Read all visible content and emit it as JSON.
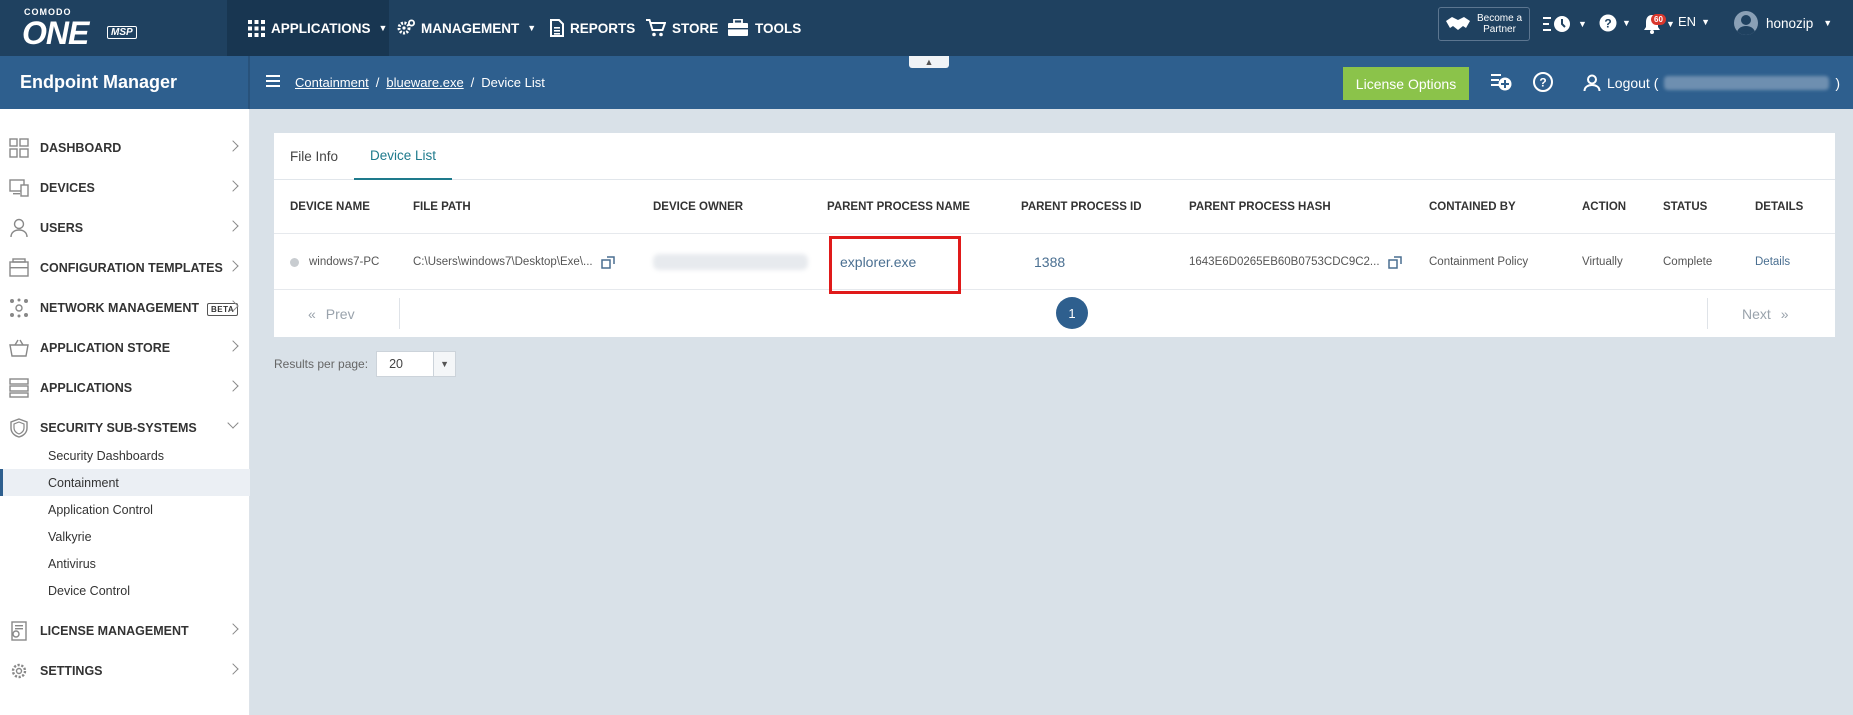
{
  "topbar": {
    "logo_brand": "COMODO",
    "logo_one": "ONE",
    "logo_msp": "MSP",
    "nav": [
      {
        "label": "APPLICATIONS",
        "icon": "grid-icon"
      },
      {
        "label": "MANAGEMENT",
        "icon": "gears-icon"
      },
      {
        "label": "REPORTS",
        "icon": "report-icon"
      },
      {
        "label": "STORE",
        "icon": "cart-icon"
      },
      {
        "label": "TOOLS",
        "icon": "toolbox-icon"
      }
    ],
    "partner_line1": "Become a",
    "partner_line2": "Partner",
    "notification_count": "60",
    "language": "EN",
    "username": "honozip"
  },
  "subbar": {
    "title": "Endpoint Manager",
    "breadcrumb": [
      "Containment",
      "blueware.exe",
      "Device List"
    ],
    "separator": "/",
    "license_button": "License Options",
    "logout_prefix": "Logout (",
    "logout_suffix": ")"
  },
  "sidebar": {
    "items": [
      {
        "label": "DASHBOARD",
        "icon": "dashboard-icon"
      },
      {
        "label": "DEVICES",
        "icon": "devices-icon"
      },
      {
        "label": "USERS",
        "icon": "user-icon"
      },
      {
        "label": "CONFIGURATION TEMPLATES",
        "icon": "templates-icon"
      },
      {
        "label": "NETWORK MANAGEMENT",
        "icon": "network-icon",
        "badge": "BETA"
      },
      {
        "label": "APPLICATION STORE",
        "icon": "store-basket-icon"
      },
      {
        "label": "APPLICATIONS",
        "icon": "applications-icon"
      },
      {
        "label": "SECURITY SUB-SYSTEMS",
        "icon": "shield-icon"
      },
      {
        "label": "LICENSE MANAGEMENT",
        "icon": "license-icon"
      },
      {
        "label": "SETTINGS",
        "icon": "gear-icon"
      }
    ],
    "security_subitems": [
      "Security Dashboards",
      "Containment",
      "Application Control",
      "Valkyrie",
      "Antivirus",
      "Device Control"
    ],
    "active_subitem": "Containment"
  },
  "tabs": [
    "File Info",
    "Device List"
  ],
  "active_tab": "Device List",
  "table": {
    "headers": [
      "DEVICE NAME",
      "FILE PATH",
      "DEVICE OWNER",
      "PARENT PROCESS NAME",
      "PARENT PROCESS ID",
      "PARENT PROCESS HASH",
      "CONTAINED BY",
      "ACTION",
      "STATUS",
      "DETAILS"
    ],
    "rows": [
      {
        "device_name": "windows7-PC",
        "file_path": "C:\\Users\\windows7\\Desktop\\Exe\\...",
        "device_owner": "",
        "parent_process_name": "explorer.exe",
        "parent_process_id": "1388",
        "parent_process_hash": "1643E6D0265EB60B0753CDC9C2...",
        "contained_by": "Containment Policy",
        "action": "Virtually",
        "status": "Complete",
        "details": "Details"
      }
    ]
  },
  "pagination": {
    "prev": "Prev",
    "next": "Next",
    "current_page": "1"
  },
  "results_per_page": {
    "label": "Results per page:",
    "value": "20"
  },
  "colors": {
    "topbar": "#1f4160",
    "subbar": "#2e5f8e",
    "license_button": "#8bc34a",
    "highlight": "#e01a1a",
    "active_tab": "#1e7a8c"
  }
}
